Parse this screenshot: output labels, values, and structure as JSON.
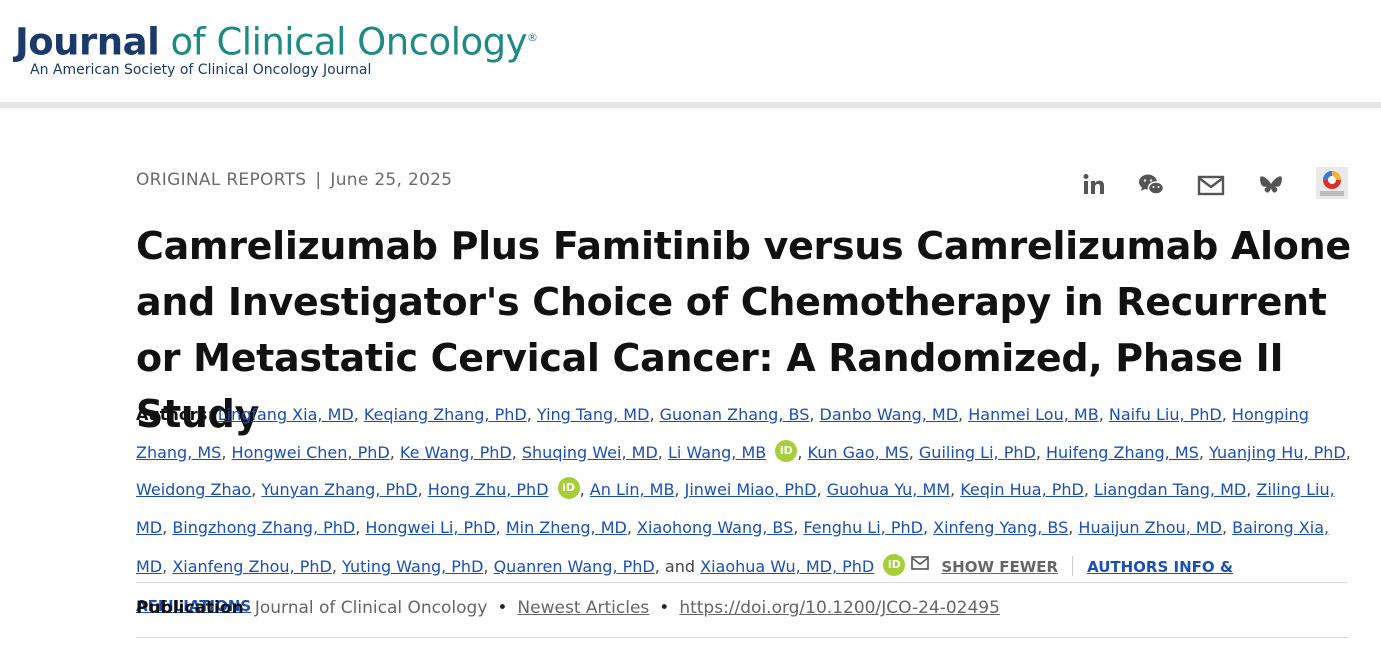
{
  "header": {
    "journal_word": "Journal",
    "journal_rest": "of Clinical Oncology",
    "registered_mark": "®",
    "subtitle": "An American Society of Clinical Oncology Journal"
  },
  "article": {
    "category": "ORIGINAL REPORTS",
    "separator": "|",
    "date": "June 25, 2025",
    "title": "Camrelizumab Plus Famitinib versus Camrelizumab Alone and Investigator's Choice of Chemotherapy in Recurrent or Metastatic Cervical Cancer: A Randomized, Phase II Study"
  },
  "share": {
    "icons": [
      "linkedin-icon",
      "wechat-icon",
      "email-icon",
      "bluesky-icon",
      "altmetric-icon"
    ]
  },
  "authors": {
    "label": "Authors",
    "colon": ":",
    "list": [
      "Lingfang Xia, MD",
      "Keqiang Zhang, PhD",
      "Ying Tang, MD",
      "Guonan Zhang, BS",
      "Danbo Wang, MD",
      "Hanmei Lou, MB",
      "Naifu Liu, PhD",
      "Hongping Zhang, MS",
      "Hongwei Chen, PhD",
      "Ke Wang, PhD",
      "Shuqing Wei, MD",
      "Li Wang, MB",
      "Kun Gao, MS",
      "Guiling Li, PhD",
      "Huifeng Zhang, MS",
      "Yuanjing Hu, PhD",
      "Weidong Zhao",
      "Yunyan Zhang, PhD",
      "Hong Zhu, PhD",
      "An Lin, MB",
      "Jinwei Miao, PhD",
      "Guohua Yu, MM",
      "Keqin Hua, PhD",
      "Liangdan Tang, MD",
      "Ziling Liu, MD",
      "Bingzhong Zhang, PhD",
      "Hongwei Li, PhD",
      "Min Zheng, MD",
      "Xiaohong Wang, BS",
      "Fenghu Li, PhD",
      "Xinfeng Yang, BS",
      "Huaijun Zhou, MD",
      "Bairong Xia, MD",
      "Xianfeng Zhou, PhD",
      "Yuting Wang, PhD",
      "Quanren Wang, PhD",
      "Xiaohua Wu, MD, PhD"
    ],
    "comma": ",",
    "and_word": ", and",
    "orcid_text": "iD",
    "show_fewer": "SHOW FEWER",
    "affiliations": "AUTHORS INFO & AFFILIATIONS"
  },
  "publication": {
    "label": "Publication",
    "colon": ":",
    "journal": "Journal of Clinical Oncology",
    "bullet": "•",
    "section": "Newest Articles",
    "doi": "https://doi.org/10.1200/JCO-24-02495"
  }
}
